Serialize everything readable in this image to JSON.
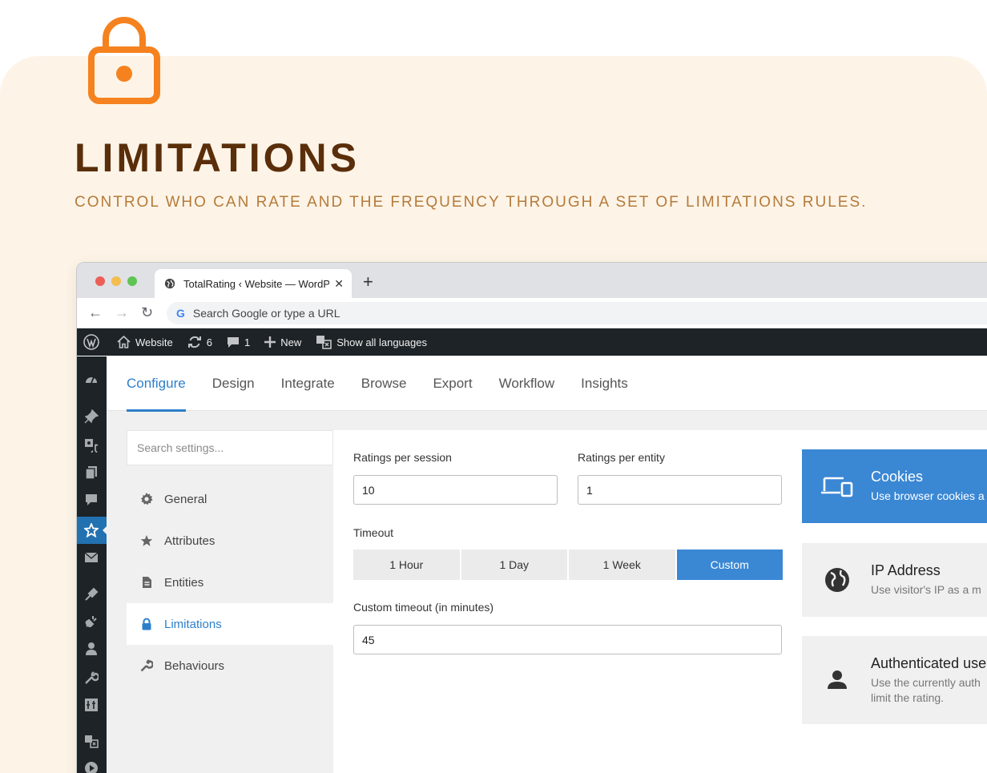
{
  "promo": {
    "headline": "LIMITATIONS",
    "subheadline": "CONTROL WHO CAN RATE AND THE FREQUENCY THROUGH A SET OF LIMITATIONS RULES.",
    "icon": "lock-icon",
    "accent_color": "#f5821f"
  },
  "browser": {
    "tab_title": "TotalRating ‹ Website — WordPress",
    "tab_close": "✕",
    "new_tab": "+",
    "address_placeholder": "Search Google or type a URL"
  },
  "adminbar": {
    "site_name": "Website",
    "updates_count": "6",
    "comments_count": "1",
    "new_label": "New",
    "languages_label": "Show all languages"
  },
  "topnav": {
    "tabs": [
      "Configure",
      "Design",
      "Integrate",
      "Browse",
      "Export",
      "Workflow",
      "Insights"
    ],
    "active": "Configure"
  },
  "settings": {
    "search_placeholder": "Search settings...",
    "menu": [
      "General",
      "Attributes",
      "Entities",
      "Limitations",
      "Behaviours"
    ],
    "active": "Limitations"
  },
  "form": {
    "ratings_per_session_label": "Ratings per session",
    "ratings_per_session_value": "10",
    "ratings_per_entity_label": "Ratings per entity",
    "ratings_per_entity_value": "1",
    "timeout_label": "Timeout",
    "timeout_options": [
      "1 Hour",
      "1 Day",
      "1 Week",
      "Custom"
    ],
    "timeout_selected": "Custom",
    "custom_timeout_label": "Custom timeout (in minutes)",
    "custom_timeout_value": "45"
  },
  "methods": [
    {
      "title": "Cookies",
      "desc": "Use browser cookies a",
      "active": true
    },
    {
      "title": "IP Address",
      "desc": "Use visitor's IP as a m",
      "active": false
    },
    {
      "title": "Authenticated use",
      "desc": "Use the currently auth",
      "desc2": "limit the rating.",
      "active": false
    }
  ],
  "colors": {
    "wp_blue": "#2271b1",
    "active_blue": "#3a87d4",
    "admin_dark": "#1d2327",
    "headline_brown": "#5a2e0a",
    "sub_brown": "#b57a3a",
    "promo_bg": "#fdf4e7"
  }
}
